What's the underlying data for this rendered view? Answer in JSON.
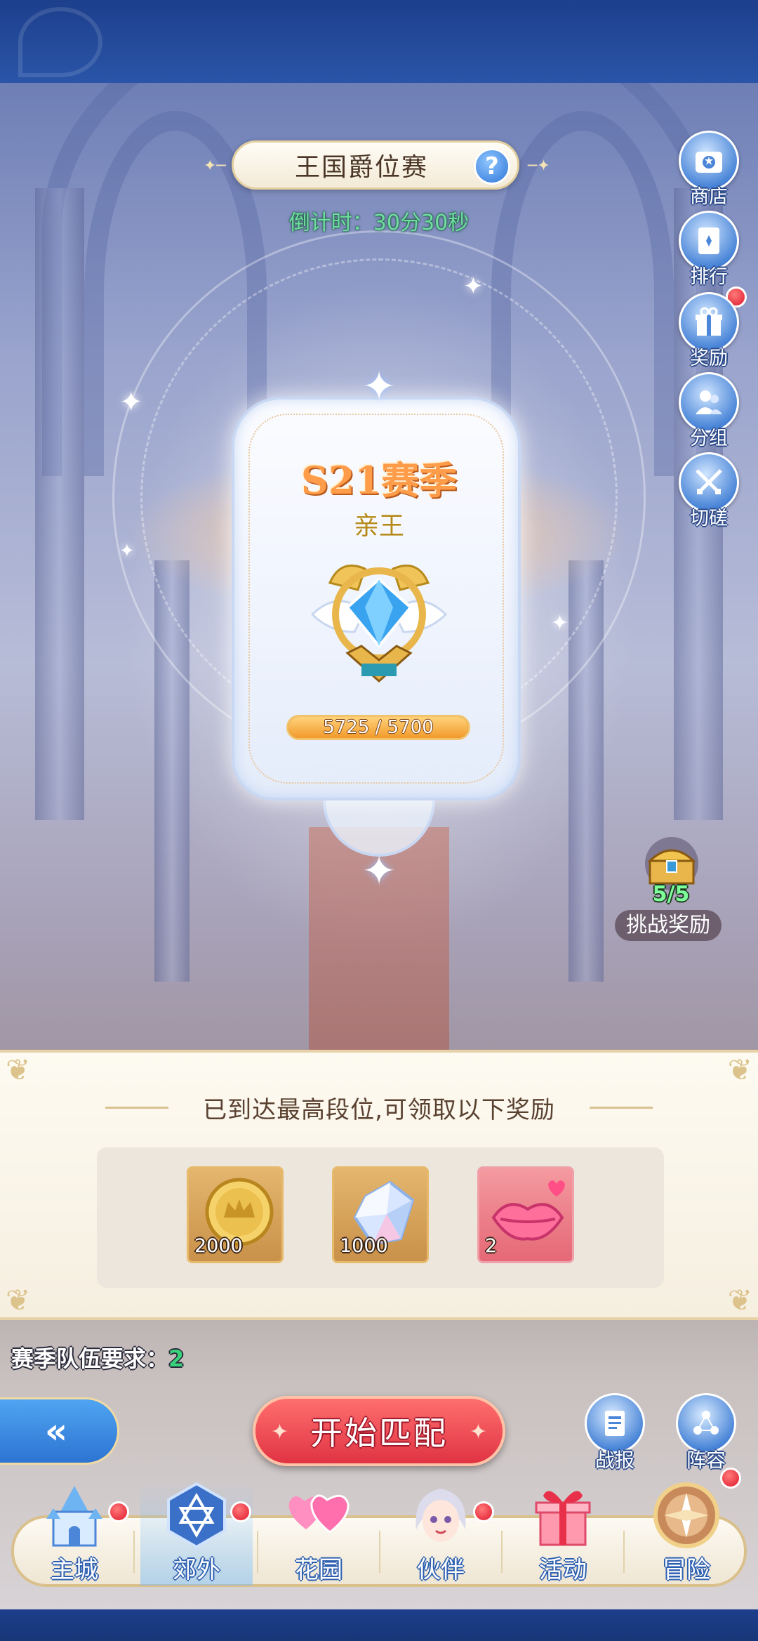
{
  "header": {
    "title": "王国爵位赛",
    "help_icon": "question-icon",
    "countdown": "倒计时：30分30秒"
  },
  "side_menu": [
    {
      "label": "商店",
      "icon": "shop-icon",
      "badge": false
    },
    {
      "label": "排行",
      "icon": "ranking-card-icon",
      "badge": true
    },
    {
      "label": "奖励",
      "icon": "gift-icon",
      "badge": false
    },
    {
      "label": "分组",
      "icon": "group-icon",
      "badge": false
    },
    {
      "label": "切磋",
      "icon": "crossed-swords-icon",
      "badge": false
    }
  ],
  "season": {
    "title": "S21赛季",
    "rank": "亲王",
    "badge_icon": "winged-diamond-crest-icon",
    "score_text": "5725 / 5700",
    "score_current": 5725,
    "score_max": 5700
  },
  "challenge_reward": {
    "icon": "treasure-chest-icon",
    "count": "5/5",
    "label": "挑战奖励"
  },
  "reward_panel": {
    "heading": "已到达最高段位,可领取以下奖励",
    "items": [
      {
        "icon": "gold-coin-icon",
        "qty": "2000"
      },
      {
        "icon": "crystal-icon",
        "qty": "1000"
      },
      {
        "icon": "heart-lips-icon",
        "qty": "2"
      }
    ]
  },
  "team_requirement": {
    "label": "赛季队伍要求：",
    "value": "2"
  },
  "actions": {
    "back_icon": "back-arrow-icon",
    "match_label": "开始匹配",
    "report_label": "战报",
    "report_icon": "report-icon",
    "lineup_label": "阵容",
    "lineup_icon": "lineup-nodes-icon"
  },
  "bottom_nav": [
    {
      "label": "主城",
      "icon": "castle-icon",
      "badge": true,
      "active": false
    },
    {
      "label": "郊外",
      "icon": "hexagram-emblem-icon",
      "badge": true,
      "active": true
    },
    {
      "label": "花园",
      "icon": "hearts-icon",
      "badge": false,
      "active": false
    },
    {
      "label": "伙伴",
      "icon": "partner-portrait-icon",
      "badge": true,
      "active": false
    },
    {
      "label": "活动",
      "icon": "gift-box-icon",
      "badge": false,
      "active": false
    },
    {
      "label": "冒险",
      "icon": "compass-icon",
      "badge": true,
      "active": false
    }
  ],
  "colors": {
    "countdown": "#6fe0a0",
    "season_title": "#ff9c4a",
    "rank_name": "#b58a1a",
    "match_button": "#e03343",
    "team_value": "#37d27a",
    "badge_red": "#e0182d"
  }
}
